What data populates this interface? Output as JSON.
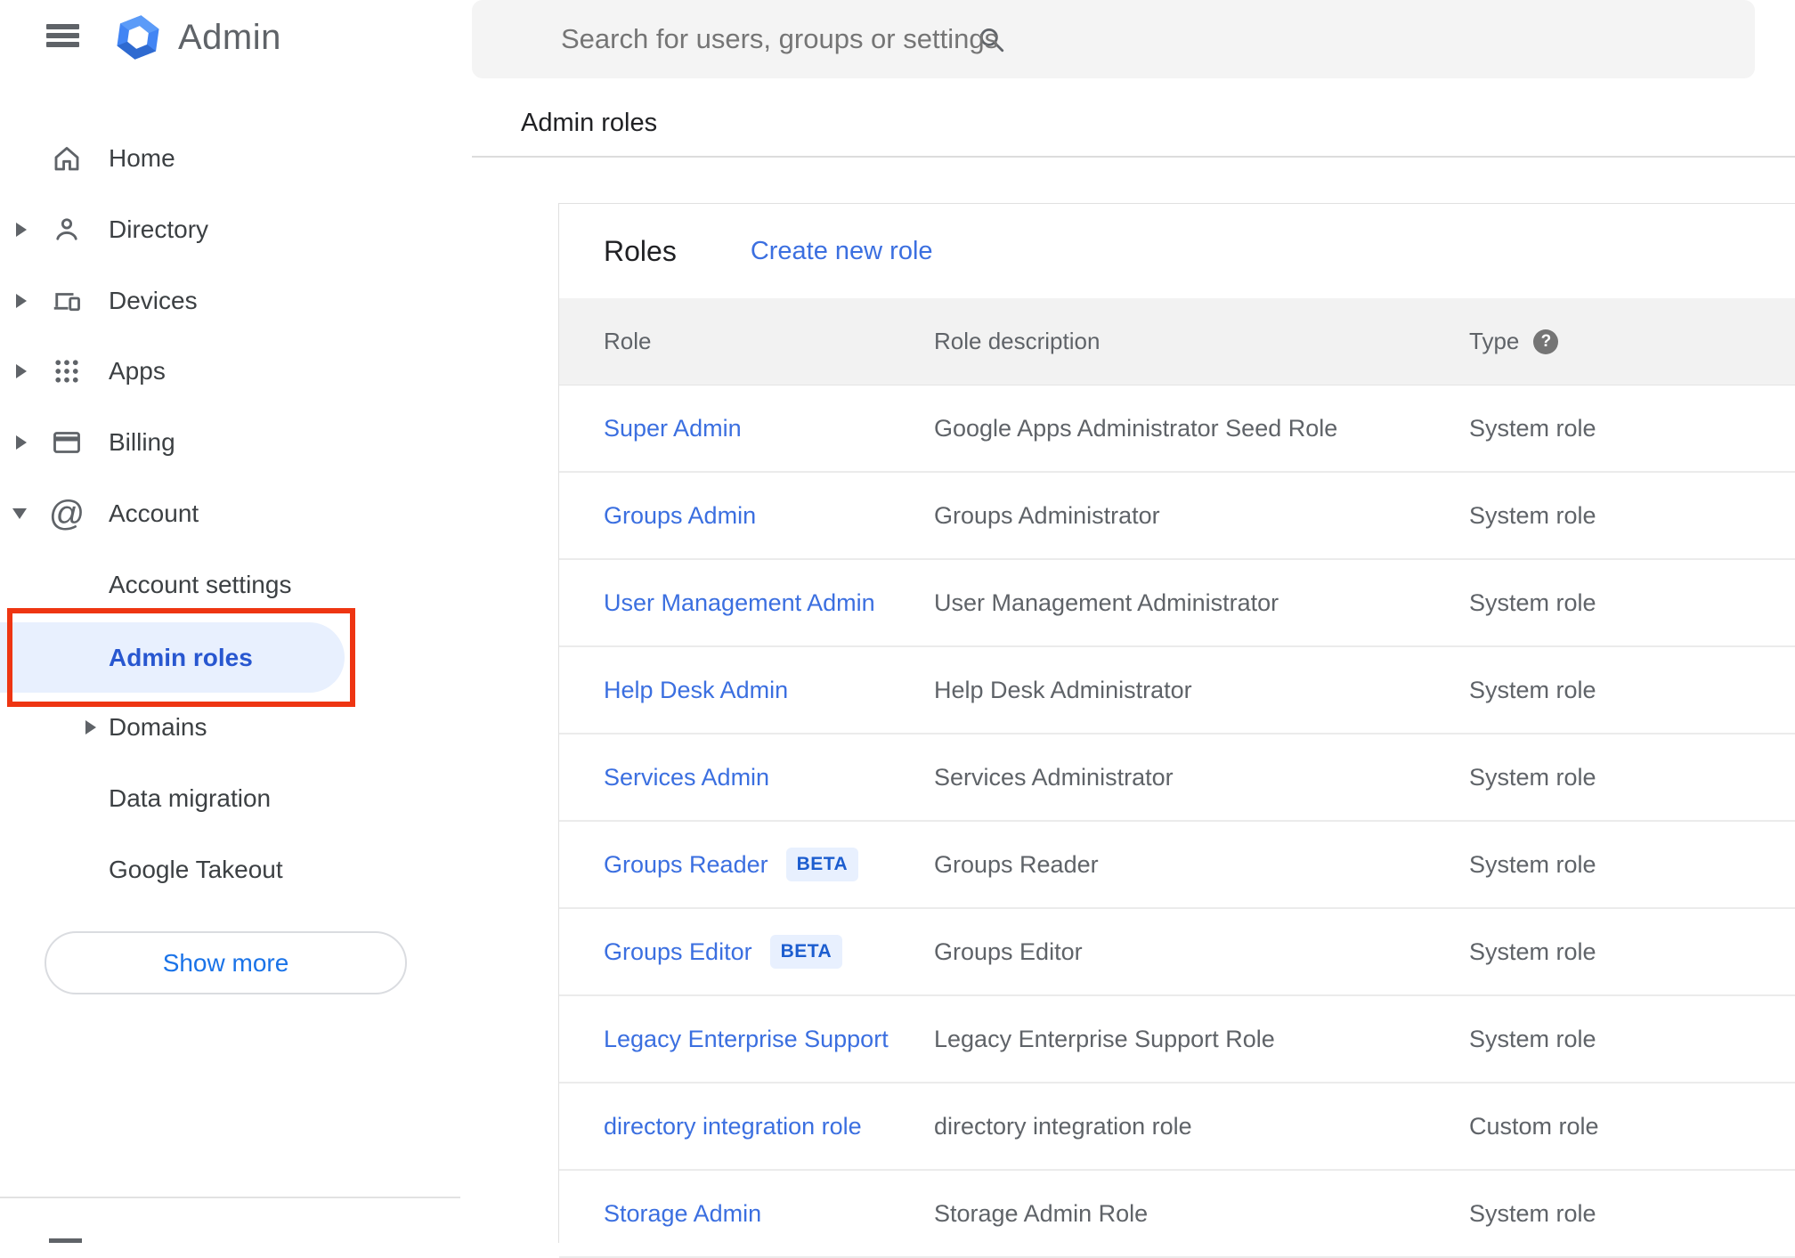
{
  "app": {
    "name": "Admin"
  },
  "header": {
    "search_placeholder": "Search for users, groups or settings",
    "breadcrumb": "Admin roles"
  },
  "sidebar": {
    "items": [
      {
        "label": "Home",
        "icon": "home-icon",
        "expandable": false
      },
      {
        "label": "Directory",
        "icon": "person-icon",
        "expandable": true
      },
      {
        "label": "Devices",
        "icon": "devices-icon",
        "expandable": true
      },
      {
        "label": "Apps",
        "icon": "apps-grid-icon",
        "expandable": true
      },
      {
        "label": "Billing",
        "icon": "credit-card-icon",
        "expandable": true
      },
      {
        "label": "Account",
        "icon": "at-sign-icon",
        "expanded": true
      }
    ],
    "account_children": [
      {
        "label": "Account settings"
      },
      {
        "label": "Admin roles",
        "active": true,
        "annotated": true
      },
      {
        "label": "Domains",
        "expandable": true
      },
      {
        "label": "Data migration"
      },
      {
        "label": "Google Takeout"
      }
    ],
    "show_more_label": "Show more"
  },
  "main": {
    "card_title": "Roles",
    "create_link": "Create new role",
    "table": {
      "columns": [
        "Role",
        "Role description",
        "Type"
      ],
      "type_help_glyph": "?",
      "rows": [
        {
          "role": "Super Admin",
          "badge": "",
          "description": "Google Apps Administrator Seed Role",
          "type": "System role"
        },
        {
          "role": "Groups Admin",
          "badge": "",
          "description": "Groups Administrator",
          "type": "System role"
        },
        {
          "role": "User Management Admin",
          "badge": "",
          "description": "User Management Administrator",
          "type": "System role"
        },
        {
          "role": "Help Desk Admin",
          "badge": "",
          "description": "Help Desk Administrator",
          "type": "System role"
        },
        {
          "role": "Services Admin",
          "badge": "",
          "description": "Services Administrator",
          "type": "System role"
        },
        {
          "role": "Groups Reader",
          "badge": "BETA",
          "description": "Groups Reader",
          "type": "System role"
        },
        {
          "role": "Groups Editor",
          "badge": "BETA",
          "description": "Groups Editor",
          "type": "System role"
        },
        {
          "role": "Legacy Enterprise Support",
          "badge": "",
          "description": "Legacy Enterprise Support Role",
          "type": "System role"
        },
        {
          "role": "directory integration role",
          "badge": "",
          "description": "directory integration role",
          "type": "Custom role"
        },
        {
          "role": "Storage Admin",
          "badge": "",
          "description": "Storage Admin Role",
          "type": "System role"
        }
      ]
    }
  },
  "colors": {
    "link_blue": "#3b6fe0",
    "active_item_text": "#2857d0",
    "active_item_bg": "#e8f0fe",
    "annotation_red": "#ee3512",
    "beta_badge_bg": "#e8f0fe",
    "beta_badge_text": "#1c5dcf",
    "accent_blue": "#1a73e8",
    "icon_gray": "#5f6368",
    "table_header_bg": "#f2f2f2"
  }
}
